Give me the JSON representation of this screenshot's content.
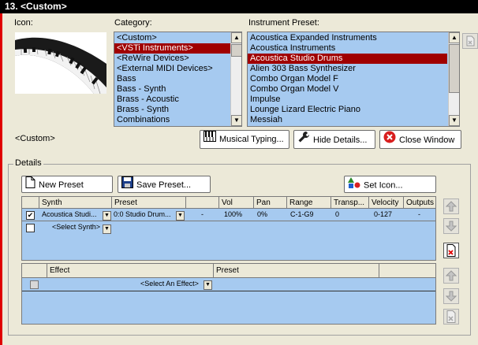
{
  "window": {
    "title": "13. <Custom>"
  },
  "labels": {
    "icon": "Icon:",
    "category": "Category:",
    "instrument_preset": "Instrument Preset:",
    "preset_name": "<Custom>",
    "details": "Details"
  },
  "category": {
    "items": [
      "<Custom>",
      "<VSTi Instruments>",
      "<ReWire Devices>",
      "<External MIDI Devices>",
      "Bass",
      "Bass - Synth",
      "Brass - Acoustic",
      "Brass - Synth",
      "Combinations"
    ],
    "selected": "<VSTi Instruments>"
  },
  "instrument_preset": {
    "items": [
      "Acoustica Expanded Instruments",
      "Acoustica Instruments",
      "Acoustica Studio Drums",
      "Alien 303 Bass Synthesizer",
      "Combo Organ Model F",
      "Combo Organ Model V",
      "Impulse",
      "Lounge Lizard Electric Piano",
      "Messiah"
    ],
    "selected": "Acoustica Studio Drums"
  },
  "buttons": {
    "musical_typing": "Musical Typing...",
    "hide_details": "Hide Details...",
    "close_window": "Close Window",
    "new_preset": "New Preset",
    "save_preset": "Save Preset...",
    "set_icon": "Set Icon..."
  },
  "synth_table": {
    "columns": [
      "Synth",
      "Preset",
      "",
      "Vol",
      "Pan",
      "Range",
      "Transp...",
      "Velocity",
      "Outputs"
    ],
    "rows": [
      {
        "checked": true,
        "synth": "Acoustica Studi...",
        "preset": "0:0 Studio Drum...",
        "blank": "-",
        "vol": "100%",
        "pan": "0%",
        "range": "C-1-G9",
        "transpose": "0",
        "velocity": "0-127",
        "outputs": "-"
      }
    ],
    "add_row": "<Select Synth>"
  },
  "effect_table": {
    "columns": [
      "Effect",
      "Preset"
    ],
    "add_row": "<Select An Effect>"
  },
  "colors": {
    "list_bg": "#a6caf0",
    "selection": "#a00000",
    "title_bg": "#000000"
  }
}
